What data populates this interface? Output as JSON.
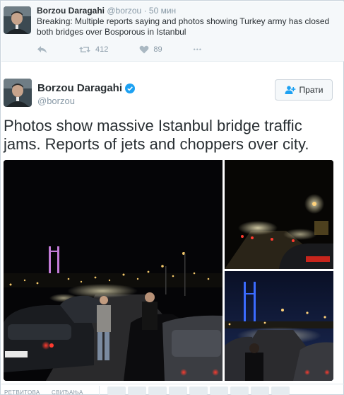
{
  "top_tweet": {
    "name": "Borzou Daragahi",
    "handle": "@borzou",
    "separator": "·",
    "time": "50 мин",
    "text": "Breaking: Multiple reports saying and photos showing Turkey army has closed both bridges over Bosporous in Istanbul",
    "retweet_count": "412",
    "like_count": "89",
    "more_label": "•••"
  },
  "main_tweet": {
    "name": "Borzou Daragahi",
    "handle": "@borzou",
    "follow_label": "Прати",
    "text": "Photos show massive Istanbul bridge traffic jams. Reports of jets and choppers over city."
  },
  "stats": {
    "retweets_label": "РЕТВИТОВА",
    "likes_label": "СВИЂАЊА"
  },
  "icons": {
    "reply": "reply-icon",
    "retweet": "retweet-icon",
    "like": "heart-icon",
    "more": "more-icon",
    "verified": "verified-badge-icon",
    "follow": "follow-person-icon"
  },
  "colors": {
    "accent": "#1da1f2",
    "muted": "#8899a6",
    "text": "#292f33"
  }
}
